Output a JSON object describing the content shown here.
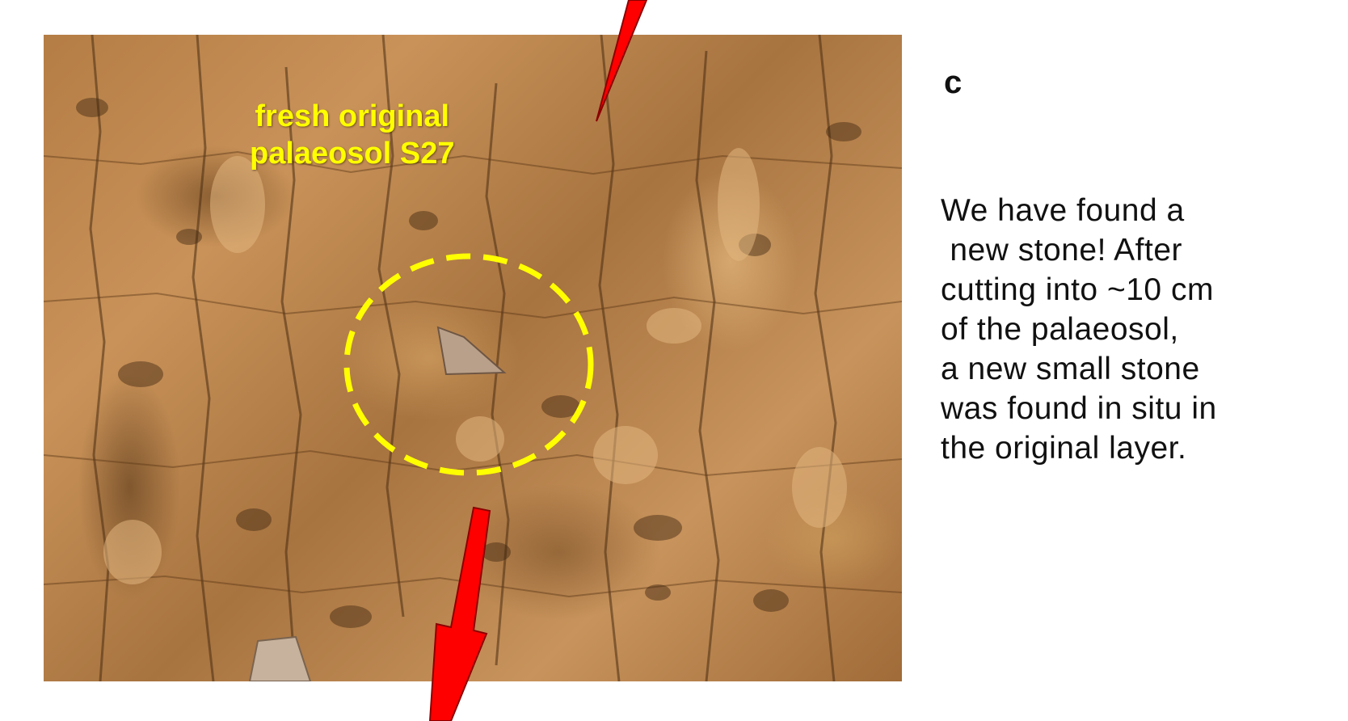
{
  "photo": {
    "label_lines": [
      "fresh original",
      "palaeosol S27"
    ],
    "label_color": "#ffff00",
    "circle_color": "#ffff00",
    "arrow_color": "#ff0000"
  },
  "panel_letter": "c",
  "caption_lines": [
    "We have found a",
    " new stone! After",
    "cutting into ~10 cm",
    "of the palaeosol,",
    "a new small stone",
    "was found in situ in",
    "the original layer."
  ]
}
